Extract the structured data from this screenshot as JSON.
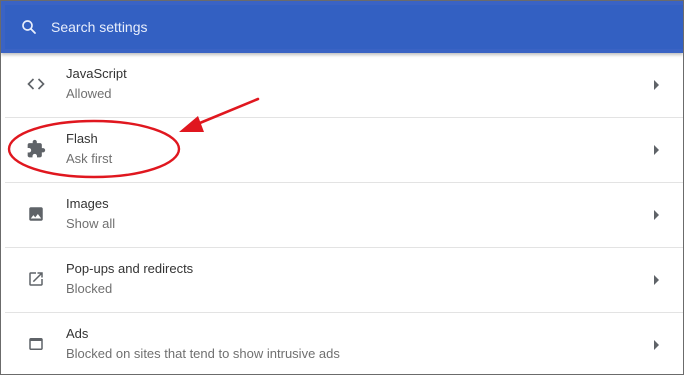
{
  "search": {
    "placeholder": "Search settings",
    "icon": "search-icon"
  },
  "rows": [
    {
      "title": "JavaScript",
      "subtitle": "Allowed",
      "icon": "code-icon"
    },
    {
      "title": "Flash",
      "subtitle": "Ask first",
      "icon": "puzzle-icon"
    },
    {
      "title": "Images",
      "subtitle": "Show all",
      "icon": "image-icon"
    },
    {
      "title": "Pop-ups and redirects",
      "subtitle": "Blocked",
      "icon": "open-in-new-icon"
    },
    {
      "title": "Ads",
      "subtitle": "Blocked on sites that tend to show intrusive ads",
      "icon": "window-icon"
    }
  ],
  "colors": {
    "header": "#3360c2",
    "annotation": "#e0171f",
    "icon": "#5f6368"
  }
}
